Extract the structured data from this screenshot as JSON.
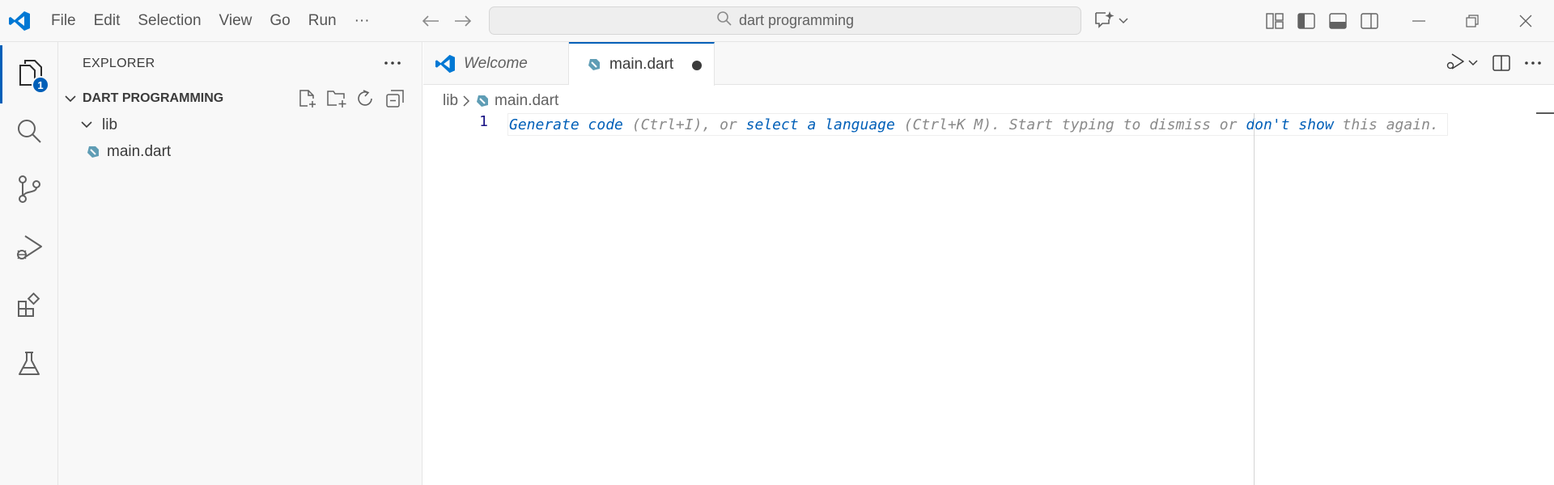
{
  "menu": [
    "File",
    "Edit",
    "Selection",
    "View",
    "Go",
    "Run",
    "···"
  ],
  "search": {
    "text": "dart programming"
  },
  "activity_badge": "1",
  "explorer": {
    "header": "EXPLORER",
    "section_title": "DART PROGRAMMING",
    "folder": "lib",
    "file": "main.dart"
  },
  "tabs": {
    "welcome": "Welcome",
    "active": "main.dart"
  },
  "breadcrumb": {
    "folder": "lib",
    "file": "main.dart"
  },
  "editor": {
    "line_number": "1",
    "hint_generate": "Generate code",
    "hint_part1": " (Ctrl+I), or ",
    "hint_select": "select a language",
    "hint_part2": " (Ctrl+K M). Start typing to dismiss or ",
    "hint_dontshow": "don't show",
    "hint_part3": " this again."
  },
  "colors": {
    "accent": "#005fb8",
    "dart": "#5f9db5"
  }
}
